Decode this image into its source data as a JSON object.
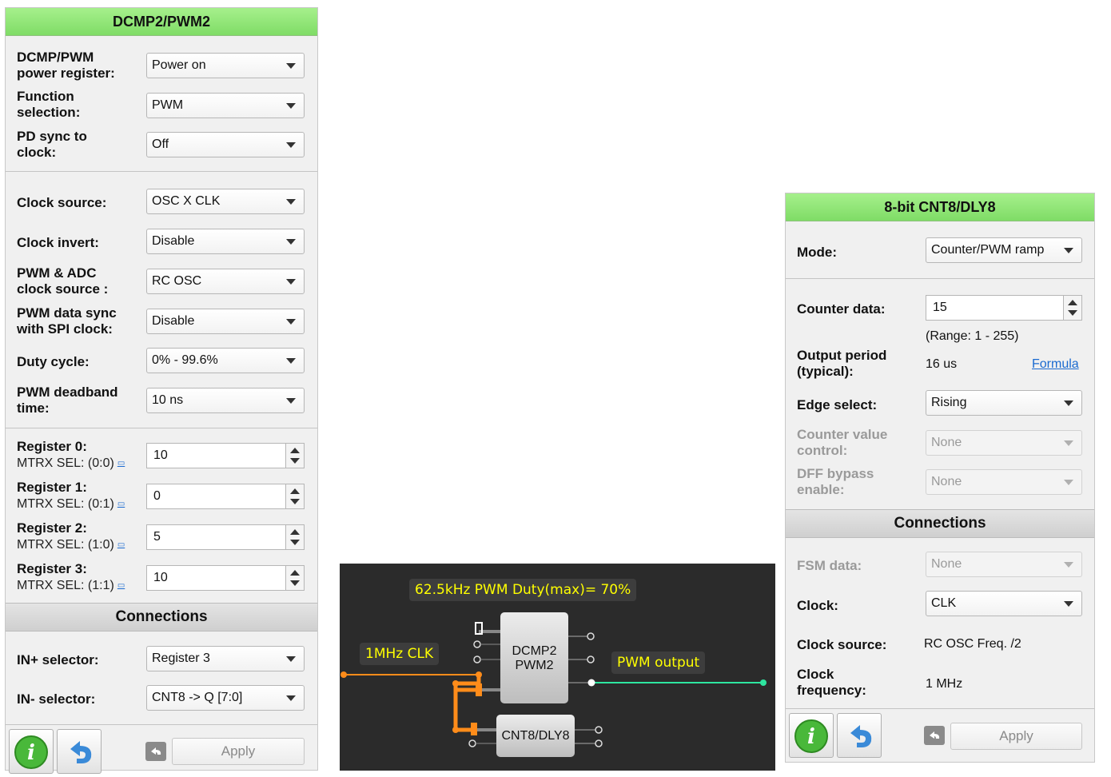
{
  "left_panel": {
    "title": "DCMP2/PWM2",
    "fields": [
      {
        "label": "DCMP/PWM power register:",
        "value": "Power on"
      },
      {
        "label": "Function selection:",
        "value": "PWM"
      },
      {
        "label": "PD sync to clock:",
        "value": "Off"
      },
      {
        "label": "Clock source:",
        "value": "OSC X CLK"
      },
      {
        "label": "Clock invert:",
        "value": "Disable"
      },
      {
        "label": "PWM & ADC clock source :",
        "value": "RC OSC"
      },
      {
        "label": "PWM data sync with SPI clock:",
        "value": "Disable"
      },
      {
        "label": "Duty cycle:",
        "value": "0% - 99.6%"
      },
      {
        "label": "PWM deadband time:",
        "value": "10 ns"
      }
    ],
    "registers": [
      {
        "label": "Register 0:",
        "mtrx": "MTRX SEL: (0:0)",
        "value": "10"
      },
      {
        "label": "Register 1:",
        "mtrx": "MTRX SEL: (0:1)",
        "value": "0"
      },
      {
        "label": "Register 2:",
        "mtrx": "MTRX SEL: (1:0)",
        "value": "5"
      },
      {
        "label": "Register 3:",
        "mtrx": "MTRX SEL: (1:1)",
        "value": "10"
      }
    ],
    "connections_title": "Connections",
    "connections": [
      {
        "label": "IN+ selector:",
        "value": "Register 3"
      },
      {
        "label": "IN- selector:",
        "value": "CNT8 -> Q [7:0]"
      }
    ],
    "apply_label": "Apply"
  },
  "right_panel": {
    "title": "8-bit CNT8/DLY8",
    "mode_label": "Mode:",
    "mode_value": "Counter/PWM ramp",
    "counter_label": "Counter data:",
    "counter_value": "15",
    "range_text": "(Range:  1 - 255)",
    "output_period_label": "Output period (typical):",
    "output_period_value": "16 us",
    "formula_link": "Formula",
    "edge_label": "Edge select:",
    "edge_value": "Rising",
    "counter_ctrl_label": "Counter value control:",
    "counter_ctrl_value": "None",
    "dff_label": "DFF bypass enable:",
    "dff_value": "None",
    "connections_title": "Connections",
    "fsm_label": "FSM data:",
    "fsm_value": "None",
    "clock_label": "Clock:",
    "clock_value": "CLK",
    "clock_source_label": "Clock source:",
    "clock_source_value": "RC OSC Freq. /2",
    "clock_freq_label": "Clock frequency:",
    "clock_freq_value": "1 MHz",
    "apply_label": "Apply"
  },
  "diagram": {
    "pwm_caption": "62.5kHz PWM  Duty(max)= 70%",
    "clk_caption": "1MHz CLK",
    "output_caption": "PWM output",
    "block_dcmp_line1": "DCMP2",
    "block_dcmp_line2": "PWM2",
    "block_cnt": "CNT8/DLY8",
    "colors": {
      "wire_orange": "#ff8c1a",
      "wire_green": "#2ee6a0",
      "label_text": "#ffff00"
    }
  },
  "icons": {
    "info": "info-icon",
    "undo": "undo-icon"
  }
}
